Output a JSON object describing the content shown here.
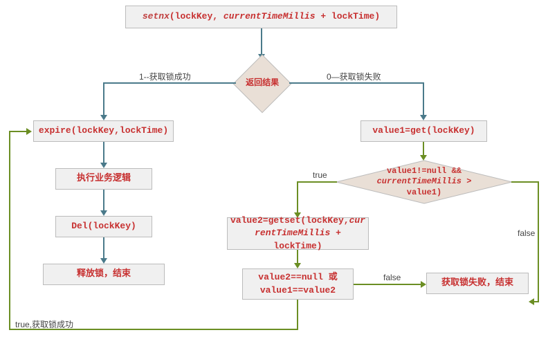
{
  "nodes": {
    "start": {
      "text_html": "<span class='keyword'>setnx</span>(lockKey, <span class='italic'>currentTimeMillis</span> + lockTime)"
    },
    "decision1": "返回结果",
    "expire": "expire(lockKey,lockTime)",
    "business": "执行业务逻辑",
    "del": "Del(lockKey)",
    "release": "释放锁，结束",
    "getvalue1": "value1=get(lockKey)",
    "decision2": {
      "text_html": "value1!=null &amp;&amp;<br><span class='italic'>currentTimeMillis</span> &gt;<br>value1)"
    },
    "getset": {
      "text_html": "value2=getset(lockKey,<span class='italic'>cur<br>rentTimeMillis</span> + lockTime)"
    },
    "decision3": {
      "text_html": "value2==null 或<br>value1==value2"
    },
    "fail": "获取锁失败，结束"
  },
  "edge_labels": {
    "success": "1--获取锁成功",
    "failure": "0—获取锁失败",
    "true": "true",
    "false": "false",
    "loop": "true,获取锁成功"
  },
  "colors": {
    "box_text": "#c73030",
    "box_bg": "#f0f0f0",
    "diamond_bg": "#e9dfd6",
    "arrow_blue": "#4a7a8a",
    "arrow_green": "#6b8e23"
  },
  "chart_data": {
    "type": "flowchart",
    "title": "Redis SETNX distributed lock",
    "nodes": [
      {
        "id": "start",
        "kind": "process",
        "label": "setnx(lockKey, currentTimeMillis + lockTime)"
      },
      {
        "id": "decision1",
        "kind": "decision",
        "label": "返回结果"
      },
      {
        "id": "expire",
        "kind": "process",
        "label": "expire(lockKey,lockTime)"
      },
      {
        "id": "business",
        "kind": "process",
        "label": "执行业务逻辑"
      },
      {
        "id": "del",
        "kind": "process",
        "label": "Del(lockKey)"
      },
      {
        "id": "release",
        "kind": "process",
        "label": "释放锁，结束"
      },
      {
        "id": "getvalue1",
        "kind": "process",
        "label": "value1=get(lockKey)"
      },
      {
        "id": "decision2",
        "kind": "decision",
        "label": "value1!=null && currentTimeMillis > value1)"
      },
      {
        "id": "getset",
        "kind": "process",
        "label": "value2=getset(lockKey,currentTimeMillis + lockTime)"
      },
      {
        "id": "decision3",
        "kind": "decision",
        "label": "value2==null 或 value1==value2"
      },
      {
        "id": "fail",
        "kind": "process",
        "label": "获取锁失败，结束"
      }
    ],
    "edges": [
      {
        "from": "start",
        "to": "decision1",
        "label": ""
      },
      {
        "from": "decision1",
        "to": "expire",
        "label": "1--获取锁成功"
      },
      {
        "from": "decision1",
        "to": "getvalue1",
        "label": "0—获取锁失败"
      },
      {
        "from": "expire",
        "to": "business",
        "label": ""
      },
      {
        "from": "business",
        "to": "del",
        "label": ""
      },
      {
        "from": "del",
        "to": "release",
        "label": ""
      },
      {
        "from": "getvalue1",
        "to": "decision2",
        "label": ""
      },
      {
        "from": "decision2",
        "to": "getset",
        "label": "true"
      },
      {
        "from": "decision2",
        "to": "fail",
        "label": "false"
      },
      {
        "from": "getset",
        "to": "decision3",
        "label": ""
      },
      {
        "from": "decision3",
        "to": "fail",
        "label": "false"
      },
      {
        "from": "decision3",
        "to": "expire",
        "label": "true,获取锁成功"
      }
    ]
  }
}
